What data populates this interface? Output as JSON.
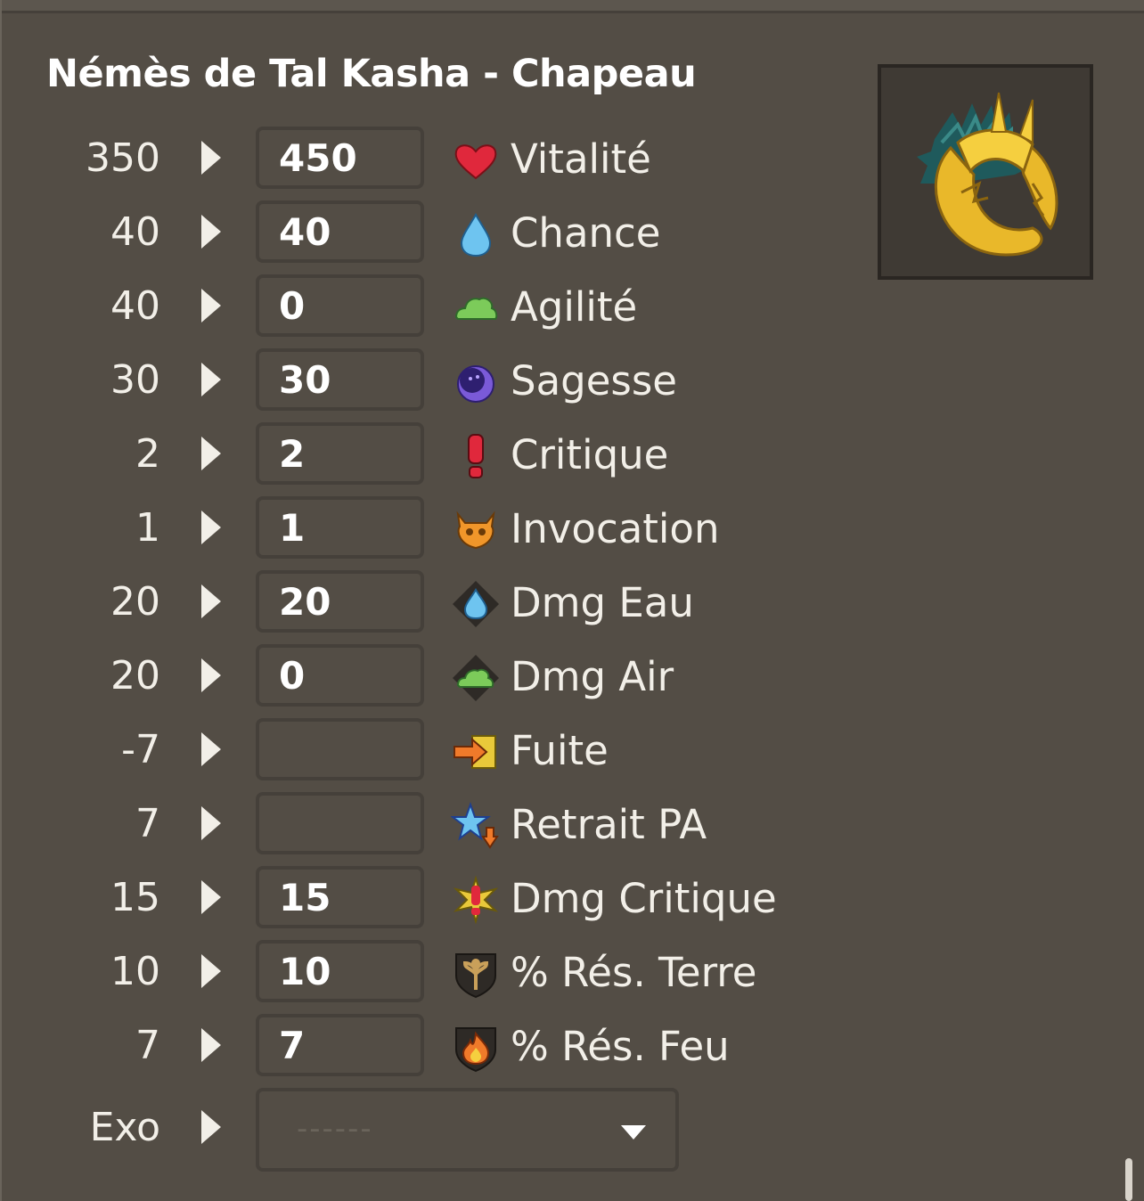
{
  "title": "Némès de Tal Kasha - Chapeau",
  "item_image": {
    "icon": "golden-tal-kasha-headdress"
  },
  "stats": [
    {
      "base": "350",
      "value": "450",
      "label": "Vitalité",
      "icon": "heart-icon"
    },
    {
      "base": "40",
      "value": "40",
      "label": "Chance",
      "icon": "water-drop-icon"
    },
    {
      "base": "40",
      "value": "0",
      "label": "Agilité",
      "icon": "air-cloud-icon"
    },
    {
      "base": "30",
      "value": "30",
      "label": "Sagesse",
      "icon": "moon-icon"
    },
    {
      "base": "2",
      "value": "2",
      "label": "Critique",
      "icon": "exclamation-icon"
    },
    {
      "base": "1",
      "value": "1",
      "label": "Invocation",
      "icon": "summon-skull-icon"
    },
    {
      "base": "20",
      "value": "20",
      "label": "Dmg Eau",
      "icon": "water-damage-icon"
    },
    {
      "base": "20",
      "value": "0",
      "label": "Dmg Air",
      "icon": "air-damage-icon"
    },
    {
      "base": "-7",
      "value": "",
      "label": "Fuite",
      "icon": "escape-arrow-icon"
    },
    {
      "base": "7",
      "value": "",
      "label": "Retrait PA",
      "icon": "ap-reduction-star-icon"
    },
    {
      "base": "15",
      "value": "15",
      "label": "Dmg Critique",
      "icon": "critical-damage-icon"
    },
    {
      "base": "10",
      "value": "10",
      "label": "% Rés. Terre",
      "icon": "earth-resistance-icon"
    },
    {
      "base": "7",
      "value": "7",
      "label": "% Rés. Feu",
      "icon": "fire-resistance-icon"
    }
  ],
  "exo": {
    "label": "Exo",
    "placeholder": "------",
    "icon": "chevron-down-icon"
  },
  "colors": {
    "background": "#534d45",
    "input_border": "#45403a",
    "text": "#f2efe8"
  }
}
